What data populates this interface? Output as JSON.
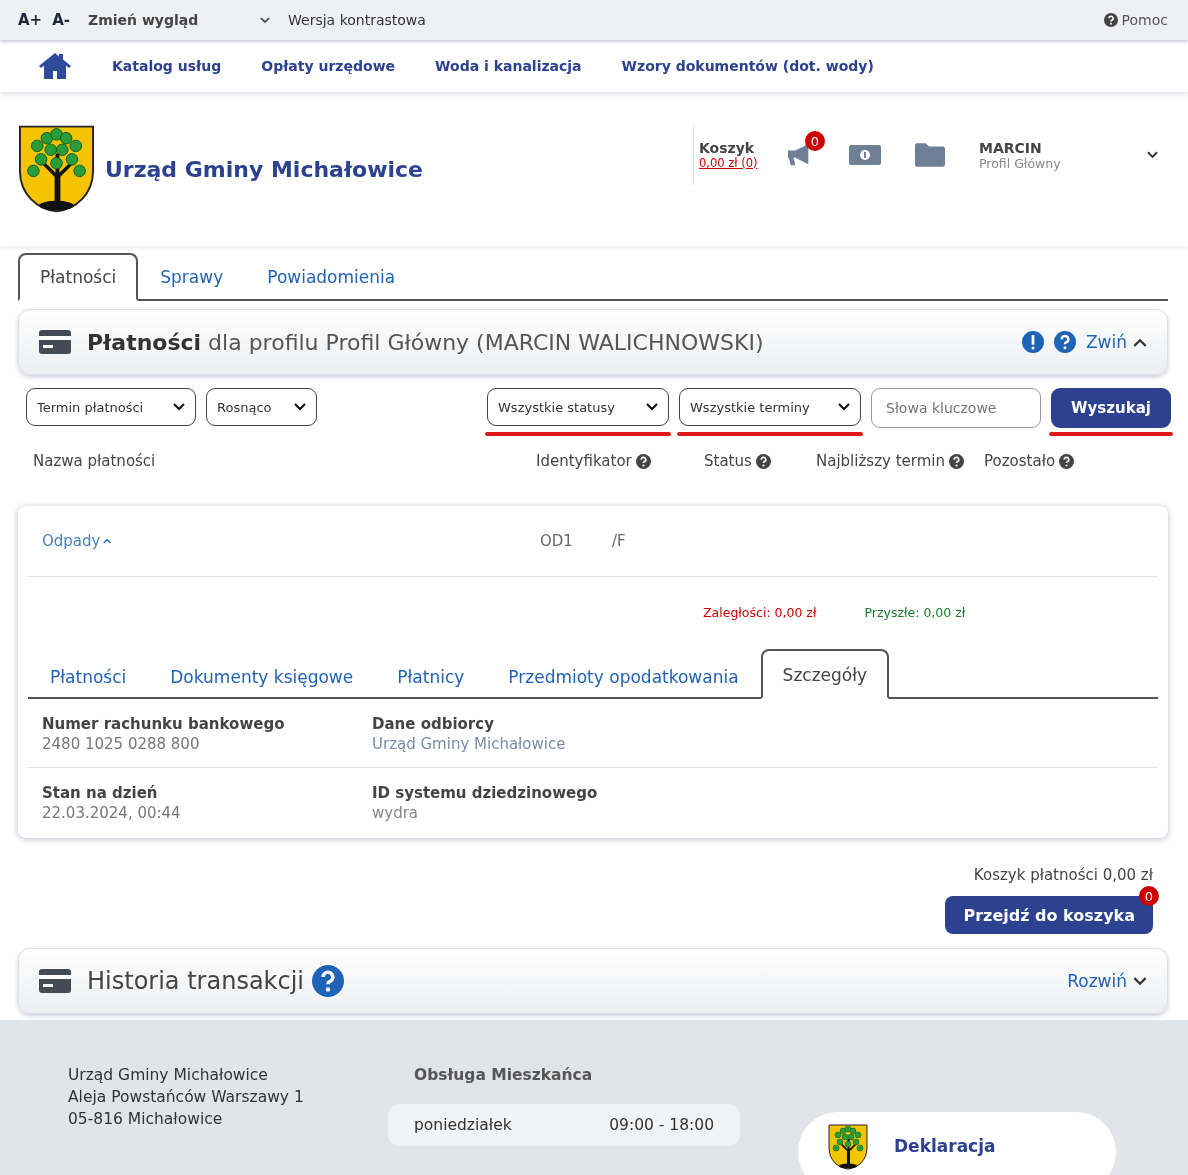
{
  "top_bar": {
    "font_buttons": [
      "A+",
      "A-"
    ],
    "appearance": "Zmień wygląd",
    "contrast": "Wersja kontrastowa",
    "help": "Pomoc"
  },
  "nav": {
    "items": [
      "Katalog usług",
      "Opłaty urzędowe",
      "Woda i kanalizacja",
      "Wzory dokumentów (dot. wody)"
    ]
  },
  "header": {
    "title": "Urząd Gminy Michałowice",
    "cart_label": "Koszyk",
    "cart_amount": "0,00 zł (0)",
    "notifications_badge": "0",
    "user_name": "MARCIN",
    "user_profile": "Profil Główny"
  },
  "tabs": [
    {
      "label": "Płatności",
      "selected": true
    },
    {
      "label": "Sprawy",
      "selected": false
    },
    {
      "label": "Powiadomienia",
      "selected": false
    }
  ],
  "payments_panel": {
    "title_bold": "Płatności",
    "title_rest": "dla profilu Profil Główny (MARCIN WALICHNOWSKI)",
    "toggle": "Zwiń",
    "expanded": true
  },
  "filters": [
    {
      "kind": "select",
      "text": "Termin płatności",
      "highlighted": false
    },
    {
      "kind": "select",
      "text": "Rosnąco",
      "highlighted": false
    },
    {
      "kind": "select",
      "text": "Wszystkie statusy",
      "highlighted": true
    },
    {
      "kind": "select",
      "text": "Wszystkie terminy",
      "highlighted": true
    },
    {
      "kind": "input",
      "placeholder": "Słowa kluczowe",
      "highlighted": false
    },
    {
      "kind": "button",
      "text": "Wyszukaj",
      "highlighted": true
    }
  ],
  "columns": [
    {
      "label": "Nazwa płatności",
      "help": false
    },
    {
      "label": "Identyfikator",
      "help": true
    },
    {
      "label": "Status",
      "help": true
    },
    {
      "label": "Najbliższy termin",
      "help": true
    },
    {
      "label": "Pozostało",
      "help": true
    }
  ],
  "payment": {
    "name": "Odpady",
    "expanded": true,
    "identifier": "OD1",
    "column_3": "/F",
    "arrears": "Zaległości: 0,00 zł",
    "future": "Przyszłe: 0,00 zł",
    "tabs": [
      {
        "label": "Płatności",
        "selected": false
      },
      {
        "label": "Dokumenty księgowe",
        "selected": false
      },
      {
        "label": "Płatnicy",
        "selected": false
      },
      {
        "label": "Przedmioty opodatkowania",
        "selected": false
      },
      {
        "label": "Szczegóły",
        "selected": true
      }
    ],
    "details": [
      {
        "label": "Numer rachunku bankowego",
        "value": "2480 1025 0288 800"
      },
      {
        "label": "Dane odbiorcy",
        "value": "Urząd Gminy Michałowice"
      },
      {
        "label": "Stan na dzień",
        "value": "22.03.2024, 00:44"
      },
      {
        "label": "ID systemu dziedzinowego",
        "value": "wydra"
      }
    ]
  },
  "basket": {
    "label": "Koszyk płatności 0,00 zł",
    "button": "Przejdź do koszyka",
    "badge": "0"
  },
  "history_panel": {
    "title": "Historia transakcji",
    "toggle": "Rozwiń",
    "expanded": false
  },
  "footer": {
    "address": [
      "Urząd Gminy Michałowice",
      "Aleja Powstańców Warszawy 1",
      "05-816 Michałowice"
    ],
    "service_title": "Obsługa Mieszkańca",
    "hours": [
      {
        "day": "poniedziałek",
        "hours": "09:00 - 18:00"
      }
    ],
    "declaration": "Deklaracja"
  }
}
